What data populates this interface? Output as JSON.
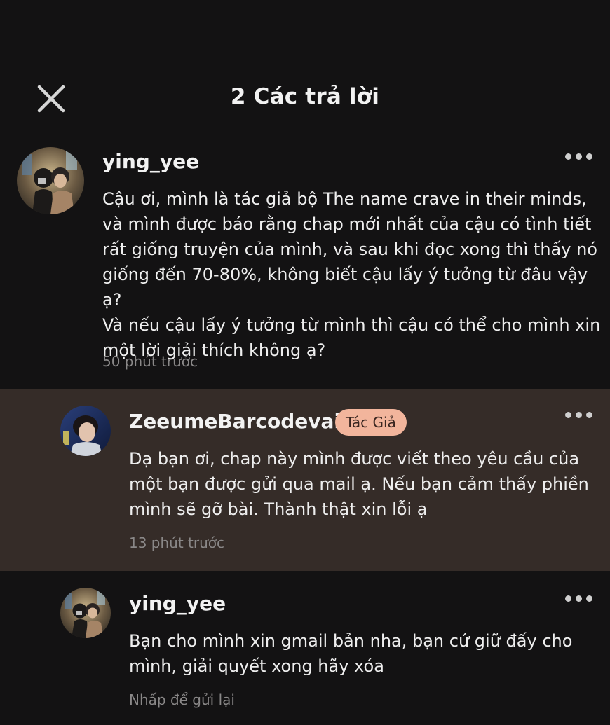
{
  "header": {
    "title": "2 Các trả lời",
    "close_icon": "close-icon"
  },
  "colors": {
    "background": "#131213",
    "highlight_row": "#352c28",
    "author_badge_bg": "#f2b59c",
    "meta_text": "#8a8888"
  },
  "comments": [
    {
      "username": "ying_yee",
      "text": "Cậu ơi, mình là tác giả bộ The name crave in their minds,\nvà mình được báo rằng chap mới nhất của cậu có tình tiết\nrất giống truyện của mình, và sau khi đọc xong thì thấy nó\ngiống đến 70-80%, không biết cậu lấy ý tưởng từ đâu vậy ạ?\nVà nếu cậu lấy ý tưởng từ mình thì cậu có thể cho mình xin\nmột lời giải thích không ạ?",
      "time": "50 phút trước",
      "more_icon": "more-horizontal-icon"
    },
    {
      "username": "ZeeumeBarcodevaiii",
      "badge": "Tác Giả",
      "text": "Dạ bạn ơi, chap này mình được viết theo yêu cầu của\nmột bạn được gửi qua mail ạ. Nếu bạn cảm thấy phiền\nmình sẽ gỡ bài. Thành thật xin lỗi ạ",
      "time": "13 phút trước",
      "more_icon": "more-horizontal-icon"
    },
    {
      "username": "ying_yee",
      "text": "Bạn cho mình xin gmail bản nha, bạn cứ giữ đấy cho\nmình, giải quyết xong hãy xóa",
      "status": "Nhấp để gửi lại",
      "more_icon": "more-horizontal-icon"
    }
  ]
}
